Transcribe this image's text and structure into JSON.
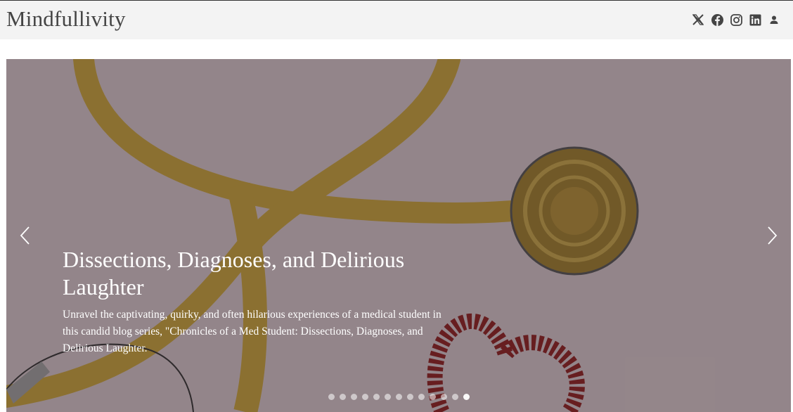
{
  "brand": "Mindfullivity",
  "social_icons": [
    "x-icon",
    "facebook-icon",
    "instagram-icon",
    "linkedin-icon",
    "user-icon"
  ],
  "hero": {
    "title": "Dissections, Diagnoses, and Delirious Laughter",
    "description": "Unravel the captivating, quirky, and often hilarious experiences of a medical student in this candid blog series, \"Chronicles of a Med Student: Dissections, Diagnoses, and Delirious Laughter.",
    "slide_count": 13,
    "active_slide": 12
  },
  "colors": {
    "topbar": "#f3f3f3",
    "brand_text": "#444444",
    "hero_overlay": "rgba(40,30,35,0.38)",
    "caption_text": "#ffffff"
  }
}
